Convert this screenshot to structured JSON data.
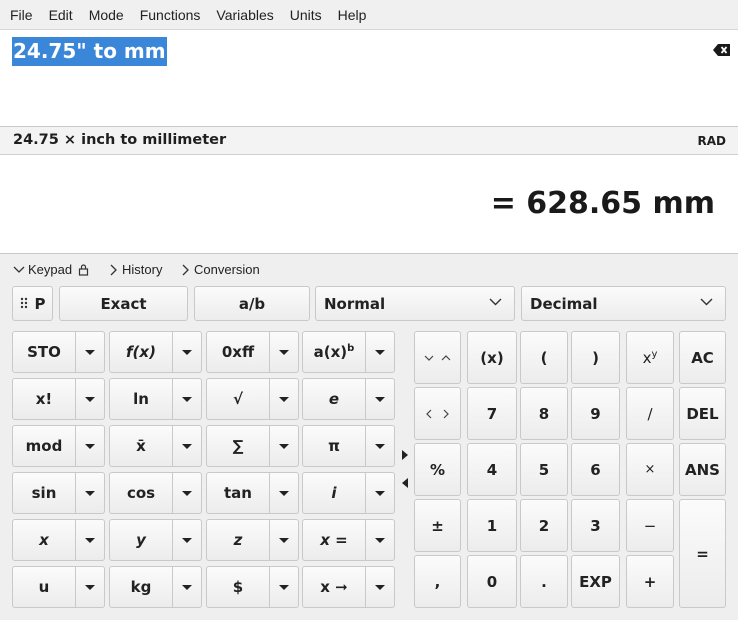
{
  "menu": [
    "File",
    "Edit",
    "Mode",
    "Functions",
    "Variables",
    "Units",
    "Help"
  ],
  "input": {
    "expression": "24.75\" to mm"
  },
  "parse": {
    "text": "24.75 × inch to millimeter",
    "angle_unit": "RAD"
  },
  "result": {
    "text": "= 628.65 mm"
  },
  "tabs": {
    "keypad": "Keypad",
    "history": "History",
    "conversion": "Conversion"
  },
  "toolbar": {
    "p_label": "P",
    "exact": "Exact",
    "fraction": "a/b",
    "mode": "Normal",
    "base": "Decimal"
  },
  "keypad_left": {
    "sto": "STO",
    "fx": "f(x)",
    "hex": "0xff",
    "pow_base": "a(x)",
    "pow_sup": "b",
    "fact": "x!",
    "ln": "ln",
    "sqrt": "√",
    "e": "e",
    "mod": "mod",
    "mean": "x̄",
    "sum": "∑",
    "pi": "π",
    "sin": "sin",
    "cos": "cos",
    "tan": "tan",
    "i": "i",
    "x": "x",
    "y": "y",
    "z": "z",
    "xeq": "x =",
    "u": "u",
    "kg": "kg",
    "dollar": "$",
    "xto": "x ➞"
  },
  "keypad_right": {
    "updown": "⌵ ⌃",
    "lr": "‹ ›",
    "percent": "%",
    "plusminus": "±",
    "comma": ",",
    "x_paren": "(x)",
    "lparen": "(",
    "rparen": ")",
    "pow_x": "x",
    "pow_y": "y",
    "d7": "7",
    "d8": "8",
    "d9": "9",
    "div": "∕",
    "d4": "4",
    "d5": "5",
    "d6": "6",
    "mul": "×",
    "d1": "1",
    "d2": "2",
    "d3": "3",
    "minus": "−",
    "d0": "0",
    "dot": ".",
    "exp": "EXP",
    "plus": "+",
    "ac": "AC",
    "del": "DEL",
    "ans": "ANS",
    "eq": "="
  }
}
